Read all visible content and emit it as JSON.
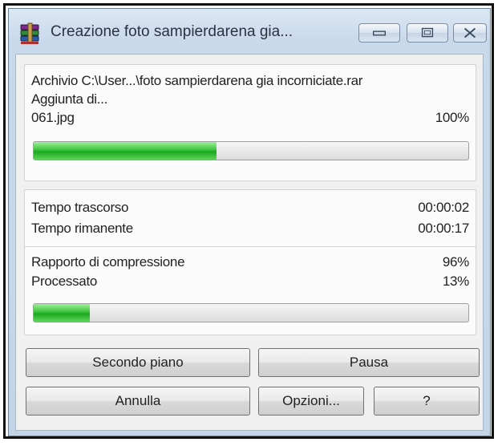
{
  "window": {
    "title": "Creazione foto sampierdarena gia...",
    "icon": "winrar-books-icon"
  },
  "file_panel": {
    "archive_line": "Archivio C:\\User...\\foto sampierdarena gia incorniciate.rar",
    "action_line": "Aggiunta di...",
    "current_file": "061.jpg",
    "current_percent": "100%",
    "file_progress": 0.42
  },
  "stats_panel": {
    "elapsed_label": "Tempo trascorso",
    "elapsed_value": "00:00:02",
    "remaining_label": "Tempo rimanente",
    "remaining_value": "00:00:17",
    "ratio_label": "Rapporto di compressione",
    "ratio_value": "96%",
    "processed_label": "Processato",
    "processed_value": "13%",
    "total_progress": 0.13
  },
  "buttons": {
    "background": "Secondo piano",
    "pause": "Pausa",
    "cancel": "Annulla",
    "options": "Opzioni...",
    "help": "?"
  },
  "colors": {
    "progress_green": "#2fbf2f",
    "titlebar": "#c9d9ec"
  }
}
